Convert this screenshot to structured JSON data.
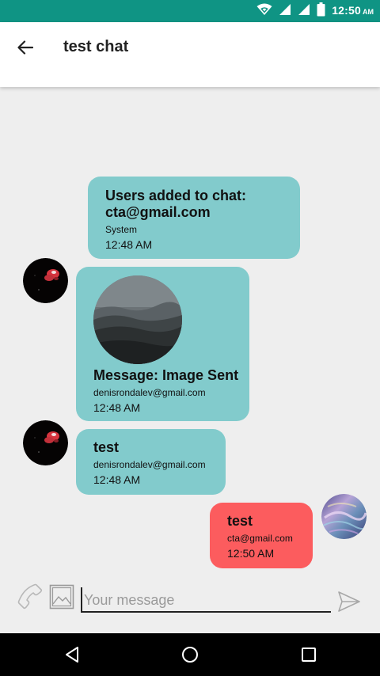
{
  "status_bar": {
    "time": "12:50",
    "ampm": "AM",
    "background_color": "#0f9484",
    "icons": [
      "wifi-icon",
      "signal-icon",
      "signal-icon",
      "battery-icon"
    ]
  },
  "app_bar": {
    "title": "test chat",
    "back_icon": "arrow-left-icon"
  },
  "messages": [
    {
      "text": "Users added to chat: cta@gmail.com",
      "sender": "System",
      "time": "12:48 AM",
      "color": "#82cbcc"
    },
    {
      "text": "Message: Image Sent",
      "sender": "denisrondalev@gmail.com",
      "time": "12:48 AM",
      "color": "#82cbcc",
      "has_image": true
    },
    {
      "text": "test",
      "sender": "denisrondalev@gmail.com",
      "time": "12:48 AM",
      "color": "#82cbcc"
    },
    {
      "text": "test",
      "sender": "cta@gmail.com",
      "time": "12:50 AM",
      "color": "#fc5c5e"
    }
  ],
  "composer": {
    "placeholder": "Your message",
    "value": "",
    "icons": [
      "phone-icon",
      "image-icon",
      "send-icon"
    ]
  },
  "nav_bar": {
    "icons": [
      "back-triangle-icon",
      "home-circle-icon",
      "recents-square-icon"
    ]
  }
}
